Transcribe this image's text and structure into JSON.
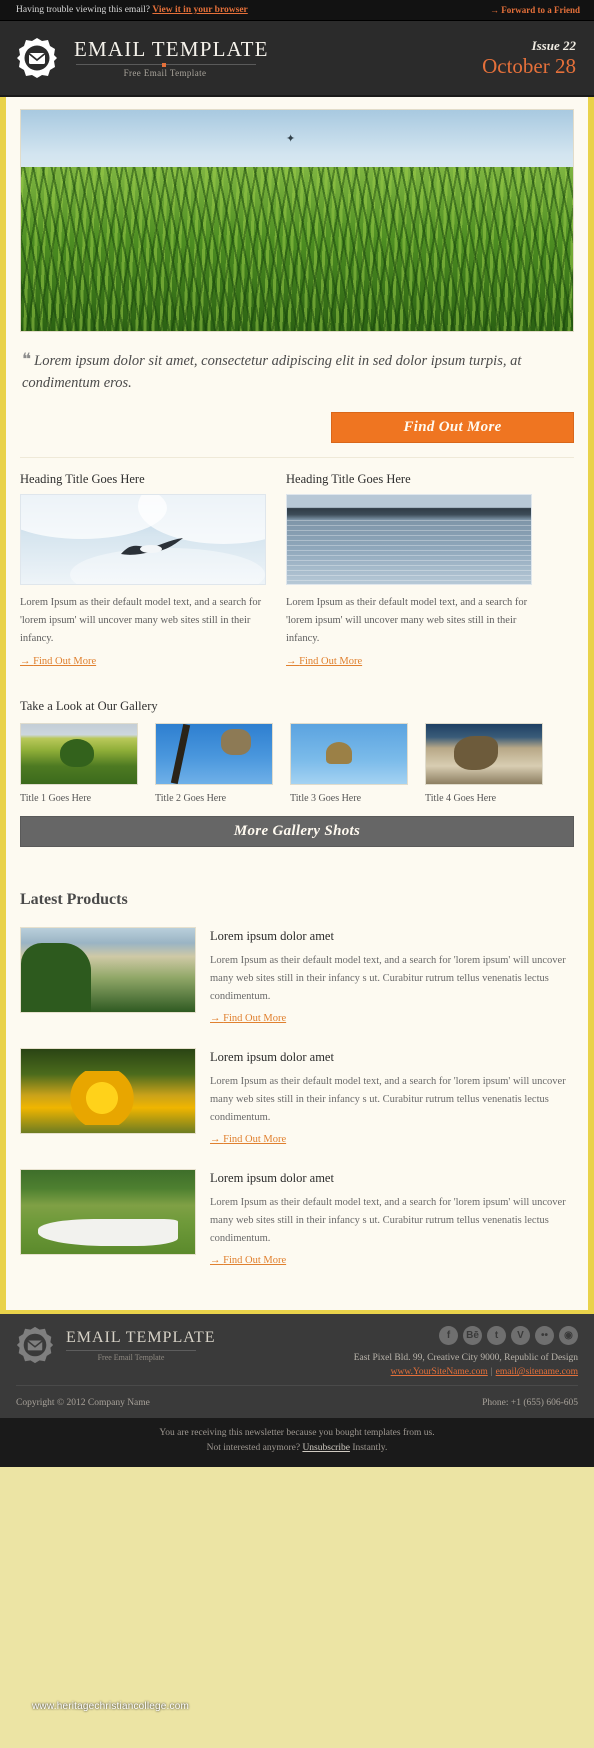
{
  "preheader": {
    "trouble_text": "Having trouble viewing this email?",
    "browser_link": "View it in your browser",
    "forward_link": "Forward to a Friend",
    "arrow": "→"
  },
  "header": {
    "logo_icon": "envelope-badge-icon",
    "brand_title": "EMAIL TEMPLATE",
    "brand_subtitle": "Free Email Template",
    "issue_label": "Issue 22",
    "issue_date": "October 28"
  },
  "hero": {
    "image_name": "grass-field-hero-image"
  },
  "quote": {
    "mark": "❝",
    "text": "Lorem ipsum dolor sit amet, consectetur adipiscing elit in sed dolor ipsum turpis, at condimentum eros.",
    "cta_label": "Find Out More"
  },
  "columns": [
    {
      "heading": "Heading Title Goes Here",
      "image_name": "seagull-in-sky-image",
      "body": "Lorem Ipsum as their default model text, and a search for 'lorem ipsum' will uncover many web sites still in their infancy.",
      "link": "Find Out More"
    },
    {
      "heading": "Heading Title Goes Here",
      "image_name": "sea-horizon-image",
      "body": "Lorem Ipsum as their default model text, and a search for 'lorem ipsum' will uncover many web sites still in their infancy.",
      "link": "Find Out More"
    }
  ],
  "gallery": {
    "heading": "Take a Look at Our Gallery",
    "items": [
      {
        "caption": "Title 1 Goes Here",
        "image_name": "green-field-tree-thumb"
      },
      {
        "caption": "Title 2 Goes Here",
        "image_name": "branch-blue-sky-thumb"
      },
      {
        "caption": "Title 3 Goes Here",
        "image_name": "dried-flower-thumb"
      },
      {
        "caption": "Title 4 Goes Here",
        "image_name": "seashell-thumb"
      }
    ],
    "more_label": "More Gallery Shots"
  },
  "products": {
    "title": "Latest Products",
    "items": [
      {
        "heading": "Lorem ipsum dolor amet",
        "body": "Lorem Ipsum as their default model text, and a search for 'lorem ipsum' will uncover many web sites still in their infancy s ut. Curabitur rutrum tellus venenatis lectus condimentum.",
        "link": "Find Out More",
        "image_name": "lake-shore-product-image"
      },
      {
        "heading": "Lorem ipsum dolor amet",
        "body": "Lorem Ipsum as their default model text, and a search for 'lorem ipsum' will uncover many web sites still in their infancy s ut. Curabitur rutrum tellus venenatis lectus condimentum.",
        "link": "Find Out More",
        "image_name": "yellow-flower-product-image"
      },
      {
        "heading": "Lorem ipsum dolor amet",
        "body": "Lorem Ipsum as their default model text, and a search for 'lorem ipsum' will uncover many web sites still in their infancy s ut. Curabitur rutrum tellus venenatis lectus condimentum.",
        "link": "Find Out More",
        "image_name": "airplane-on-grass-product-image"
      }
    ]
  },
  "footer": {
    "brand_title": "EMAIL TEMPLATE",
    "brand_subtitle": "Free Email Template",
    "social": [
      {
        "name": "facebook-icon",
        "glyph": "f"
      },
      {
        "name": "behance-icon",
        "glyph": "Bē"
      },
      {
        "name": "twitter-icon",
        "glyph": "t"
      },
      {
        "name": "vimeo-icon",
        "glyph": "V"
      },
      {
        "name": "flickr-icon",
        "glyph": "••"
      },
      {
        "name": "rss-icon",
        "glyph": "◉"
      }
    ],
    "address": "East Pixel Bld. 99, Creative City 9000, Republic of Design",
    "site_link": "www.YourSiteName.com",
    "email_link": "email@sitename.com",
    "separator": "|",
    "copyright": "Copyright © 2012 Company Name",
    "phone": "Phone: +1 (655) 606-605"
  },
  "legal": {
    "line1": "You are receiving this newsletter because you bought templates from us.",
    "line2_pre": "Not interested anymore?",
    "unsubscribe": "Unsubscribe",
    "line2_post": "Instantly."
  },
  "watermark": {
    "text": "www.heritagechristiancollege.com"
  },
  "colors": {
    "accent_orange": "#e5703a",
    "button_orange": "#ef7521",
    "frame_yellow": "#e9d24a",
    "dark_header": "#2b2b2b",
    "gray_button": "#666666"
  }
}
